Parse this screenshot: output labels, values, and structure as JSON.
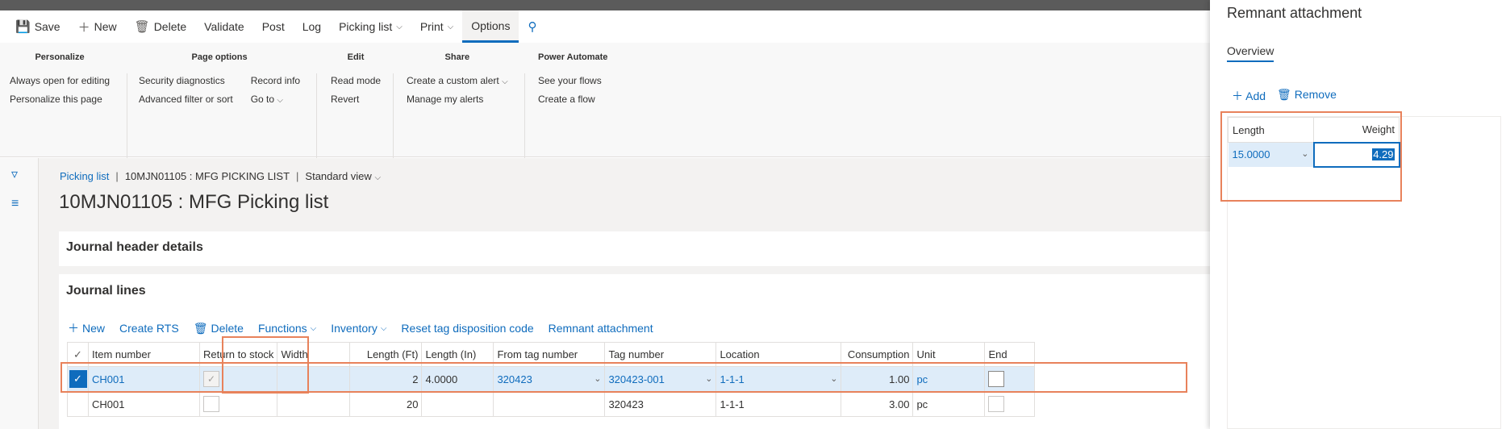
{
  "actionbar": {
    "items": [
      {
        "label": "Save",
        "icon": "save-icon"
      },
      {
        "label": "New",
        "icon": "plus-icon"
      },
      {
        "label": "Delete",
        "icon": "trash-icon"
      },
      {
        "label": "Validate"
      },
      {
        "label": "Post"
      },
      {
        "label": "Log"
      },
      {
        "label": "Picking list",
        "dropdown": true
      },
      {
        "label": "Print",
        "dropdown": true
      },
      {
        "label": "Options",
        "active": true
      }
    ]
  },
  "ribbon": {
    "personalize": {
      "title": "Personalize",
      "items": [
        "Always open for editing",
        "Personalize this page"
      ]
    },
    "page_options": {
      "title": "Page options",
      "col1": [
        "Security diagnostics",
        "Advanced filter or sort"
      ],
      "col2": [
        "Record info",
        "Go to"
      ]
    },
    "edit": {
      "title": "Edit",
      "items": [
        "Read mode",
        "Revert"
      ]
    },
    "share": {
      "title": "Share",
      "items": [
        "Create a custom alert",
        "Manage my alerts"
      ]
    },
    "power_automate": {
      "title": "Power Automate",
      "items": [
        "See your flows",
        "Create a flow"
      ]
    }
  },
  "breadcrumb": {
    "link": "Picking list",
    "record": "10MJN01105 : MFG PICKING LIST",
    "view": "Standard view"
  },
  "page_title": "10MJN01105 : MFG Picking list",
  "fasttabs": {
    "header": "Journal header details",
    "lines": "Journal lines"
  },
  "lines_toolbar": [
    "New",
    "Create RTS",
    "Delete",
    "Functions",
    "Inventory",
    "Reset tag disposition code",
    "Remnant attachment"
  ],
  "grid": {
    "columns": [
      "Item number",
      "Return to stock",
      "Width",
      "Length (Ft)",
      "Length (In)",
      "From tag number",
      "Tag number",
      "Location",
      "Consumption",
      "Unit",
      "End"
    ],
    "rows": [
      {
        "item": "CH001",
        "return": true,
        "width": "",
        "length_ft": "2",
        "length_in": "4.0000",
        "from_tag": "320423",
        "tag": "320423-001",
        "location": "1-1-1",
        "consumption": "1.00",
        "unit": "pc",
        "end": false,
        "selected": true
      },
      {
        "item": "CH001",
        "return": false,
        "width": "",
        "length_ft": "20",
        "length_in": "",
        "from_tag": "",
        "tag": "320423",
        "location": "1-1-1",
        "consumption": "3.00",
        "unit": "pc",
        "end": false,
        "selected": false
      }
    ]
  },
  "panel": {
    "title": "Remnant attachment",
    "tab": "Overview",
    "add_label": "Add",
    "remove_label": "Remove",
    "columns": [
      "Length",
      "Weight"
    ],
    "row": {
      "length": "15.0000",
      "weight": "4.29"
    }
  },
  "colors": {
    "accent": "#0f6cbd",
    "highlight_box": "#e8825b",
    "selected_row": "#deecf9"
  }
}
